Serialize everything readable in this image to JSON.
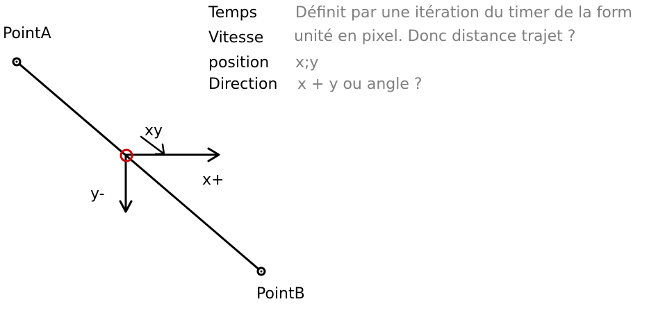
{
  "points": {
    "a_label": "PointA",
    "b_label": "PointB"
  },
  "axes": {
    "xy_label": "xy",
    "x_label": "x+",
    "y_label": "y-"
  },
  "notes": [
    {
      "term": "Temps",
      "desc": "Définit par une itération du timer de la form"
    },
    {
      "term": "Vitesse",
      "desc": "unité en pixel. Donc distance trajet ?"
    },
    {
      "term": "position",
      "desc": "x;y"
    },
    {
      "term": "Direction",
      "desc": "x + y ou angle ?"
    }
  ],
  "colors": {
    "stroke": "#000000",
    "marker": "#cc0000",
    "note_desc": "#7f7f7f"
  }
}
